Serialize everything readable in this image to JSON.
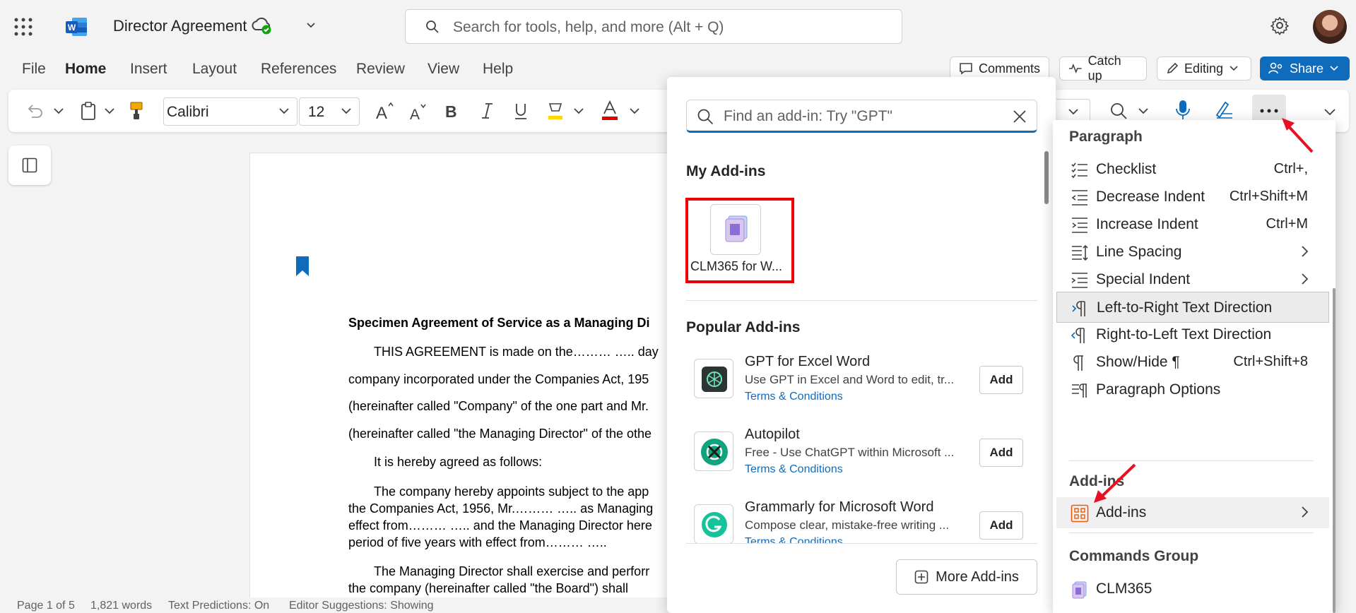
{
  "app": {
    "title": "Director Agreement",
    "search_placeholder": "Search for tools, help, and more (Alt + Q)"
  },
  "menu": [
    "File",
    "Home",
    "Insert",
    "Layout",
    "References",
    "Review",
    "View",
    "Help"
  ],
  "actions": {
    "comments": "Comments",
    "catch_up": "Catch up",
    "editing": "Editing",
    "share": "Share"
  },
  "ribbon": {
    "font": "Calibri",
    "size": "12"
  },
  "document": {
    "lines": [
      "Specimen Agreement of Service as a Managing Di",
      "THIS AGREEMENT is made on the……… ….. day",
      "company incorporated under the Companies Act, 195",
      "(hereinafter called \"Company\" of the one part and Mr.",
      "(hereinafter called \"the Managing Director\" of the othe",
      "It is hereby agreed as follows:",
      "The company hereby appoints subject to the app",
      "the Companies Act, 1956, Mr.……… ….. as Managing",
      "effect from……… ….. and the Managing Director here",
      "period of five years with effect from……… …..",
      "The Managing Director shall exercise and perforr",
      "the company (hereinafter called \"the Board\") shall"
    ]
  },
  "status": {
    "page": "Page 1 of 5",
    "words": "1,821 words",
    "predictions": "Text Predictions: On",
    "editor": "Editor Suggestions: Showing"
  },
  "addins_panel": {
    "search_placeholder": "Find an add-in: Try \"GPT\"",
    "my_addins_heading": "My Add-ins",
    "my_addins": [
      {
        "name": "CLM365 for W..."
      }
    ],
    "popular_heading": "Popular Add-ins",
    "popular": [
      {
        "title": "GPT for Excel Word",
        "desc": "Use GPT in Excel and Word to edit, tr...",
        "link": "Terms & Conditions",
        "button": "Add"
      },
      {
        "title": "Autopilot",
        "desc": "Free - Use ChatGPT within Microsoft ...",
        "link": "Terms & Conditions",
        "button": "Add"
      },
      {
        "title": "Grammarly for Microsoft Word",
        "desc": "Compose clear, mistake-free writing ...",
        "link": "Terms & Conditions",
        "button": "Add"
      }
    ],
    "more_button": "More Add-ins"
  },
  "overflow_menu": {
    "paragraph_heading": "Paragraph",
    "items": [
      {
        "label": "Checklist",
        "shortcut": "Ctrl+,"
      },
      {
        "label": "Decrease Indent",
        "shortcut": "Ctrl+Shift+M"
      },
      {
        "label": "Increase Indent",
        "shortcut": "Ctrl+M"
      },
      {
        "label": "Line Spacing",
        "shortcut": ""
      },
      {
        "label": "Special Indent",
        "shortcut": ""
      },
      {
        "label": "Left-to-Right Text Direction",
        "shortcut": ""
      },
      {
        "label": "Right-to-Left Text Direction",
        "shortcut": ""
      },
      {
        "label": "Show/Hide ¶",
        "shortcut": "Ctrl+Shift+8"
      },
      {
        "label": "Paragraph Options",
        "shortcut": ""
      }
    ],
    "addins_heading": "Add-ins",
    "addins_item": "Add-ins",
    "commands_heading": "Commands Group",
    "commands_item": "CLM365"
  },
  "colors": {
    "accent": "#0f6cbd",
    "highlight_box": "#e00000",
    "arrow": "#e81123"
  }
}
